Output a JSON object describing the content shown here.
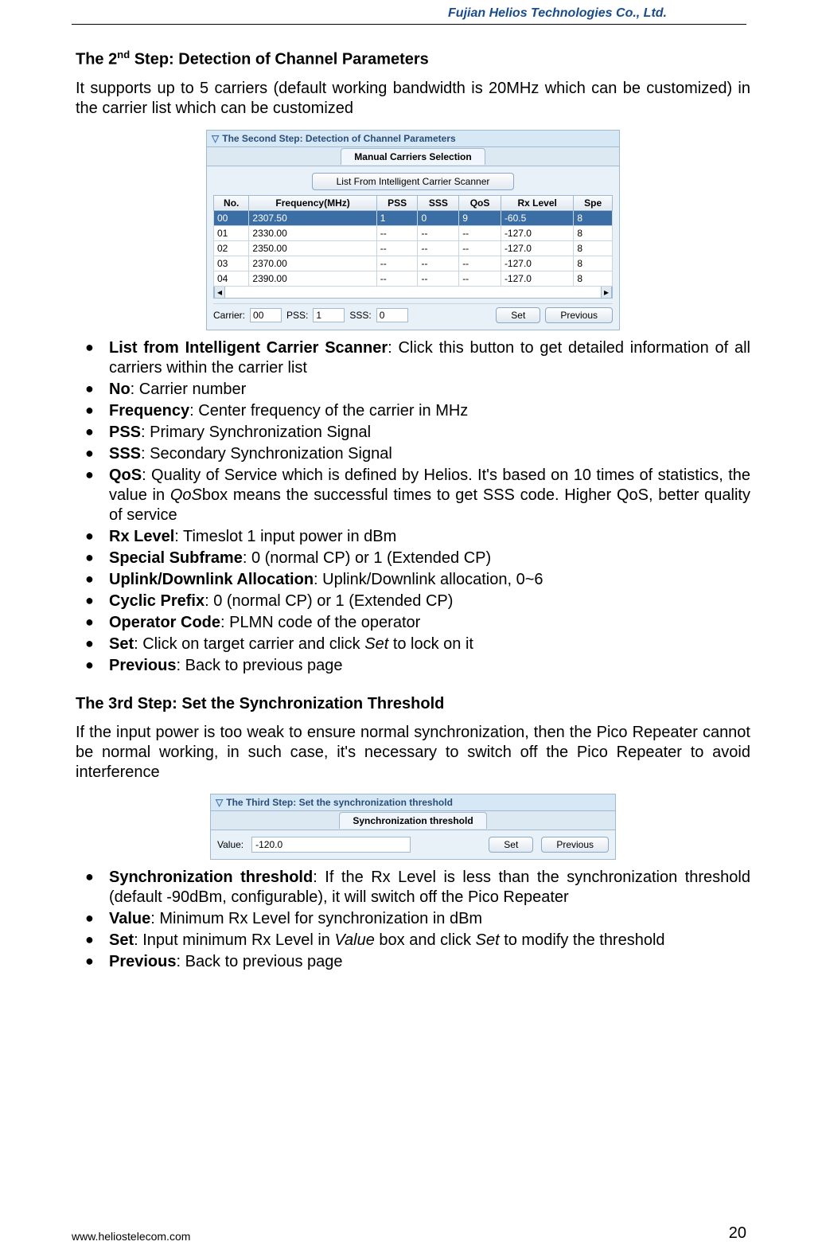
{
  "header": {
    "company": "Fujian  Helios  Technologies  Co.,  Ltd."
  },
  "footer": {
    "url": "www.heliostelecom.com",
    "page": "20"
  },
  "step2": {
    "title_prefix": "The 2",
    "title_sup": "nd",
    "title_suffix": " Step: Detection of Channel Parameters",
    "intro": "It supports up to 5 carriers (default working bandwidth is 20MHz which can be customized) in the carrier list which can be customized",
    "panel_title": "The Second Step: Detection of Channel Parameters",
    "tab": "Manual Carriers Selection",
    "list_btn": "List From Intelligent Carrier Scanner",
    "cols": [
      "No.",
      "Frequency(MHz)",
      "PSS",
      "SSS",
      "QoS",
      "Rx Level",
      "Spe"
    ],
    "rows": [
      {
        "no": "00",
        "freq": "2307.50",
        "pss": "1",
        "sss": "0",
        "qos": "9",
        "rx": "-60.5",
        "spe": "8",
        "sel": true
      },
      {
        "no": "01",
        "freq": "2330.00",
        "pss": "--",
        "sss": "--",
        "qos": "--",
        "rx": "-127.0",
        "spe": "8",
        "sel": false
      },
      {
        "no": "02",
        "freq": "2350.00",
        "pss": "--",
        "sss": "--",
        "qos": "--",
        "rx": "-127.0",
        "spe": "8",
        "sel": false
      },
      {
        "no": "03",
        "freq": "2370.00",
        "pss": "--",
        "sss": "--",
        "qos": "--",
        "rx": "-127.0",
        "spe": "8",
        "sel": false
      },
      {
        "no": "04",
        "freq": "2390.00",
        "pss": "--",
        "sss": "--",
        "qos": "--",
        "rx": "-127.0",
        "spe": "8",
        "sel": false
      }
    ],
    "labels": {
      "carrier": "Carrier:",
      "pss": "PSS:",
      "sss": "SSS:",
      "set": "Set",
      "prev": "Previous"
    },
    "inputs": {
      "carrier": "00",
      "pss": "1",
      "sss": "0"
    },
    "bullets": [
      {
        "term": "List from Intelligent Carrier Scanner",
        "desc": ": Click this button to get detailed information of all carriers within the carrier list"
      },
      {
        "term": "No",
        "desc": ": Carrier number"
      },
      {
        "term": "Frequency",
        "desc": ": Center frequency of the carrier in MHz"
      },
      {
        "term": "PSS",
        "desc": ": Primary Synchronization Signal"
      },
      {
        "term": "SSS",
        "desc": ": Secondary Synchronization Signal"
      },
      {
        "term": "QoS",
        "desc_a": ": Quality of Service which is defined by Helios. It's based on 10 times of statistics, the value in ",
        "desc_italic": "QoS",
        "desc_b": "box means the successful times to get SSS code. Higher QoS, better quality of service"
      },
      {
        "term": "Rx Level",
        "desc": ": Timeslot 1 input power in dBm"
      },
      {
        "term": "Special Subframe",
        "desc": ": 0 (normal CP) or 1 (Extended CP)"
      },
      {
        "term": "Uplink/Downlink Allocation",
        "desc": ": Uplink/Downlink allocation, 0~6"
      },
      {
        "term": "Cyclic Prefix",
        "desc": ": 0 (normal CP) or 1 (Extended CP)"
      },
      {
        "term": "Operator Code",
        "desc": ": PLMN code of the operator"
      },
      {
        "term": "Set",
        "desc_a": ": Click on target carrier and click ",
        "desc_italic": "Set",
        "desc_b": " to lock on it"
      },
      {
        "term": "Previous",
        "desc": ": Back to previous page"
      }
    ]
  },
  "step3": {
    "title": "The 3rd Step: Set the Synchronization Threshold",
    "intro": "If the input power is too weak to ensure normal synchronization, then the Pico Repeater cannot be normal working, in such case, it's necessary to switch off the Pico Repeater to avoid interference",
    "panel_title": "The Third Step: Set the synchronization threshold",
    "tab": "Synchronization threshold",
    "labels": {
      "value": "Value:",
      "set": "Set",
      "prev": "Previous"
    },
    "inputs": {
      "value": "-120.0"
    },
    "bullets": [
      {
        "term": "Synchronization threshold",
        "desc": ": If the Rx Level is less than the synchronization threshold (default -90dBm, configurable), it will switch off the Pico Repeater"
      },
      {
        "term": "Value",
        "desc": ": Minimum Rx Level for synchronization in dBm"
      },
      {
        "term": "Set",
        "desc_a": ": Input minimum Rx Level in ",
        "desc_italic": "Value",
        "desc_b": " box and click ",
        "desc_italic2": "Set",
        "desc_c": " to modify the threshold"
      },
      {
        "term": "Previous",
        "desc": ": Back to previous page"
      }
    ]
  }
}
